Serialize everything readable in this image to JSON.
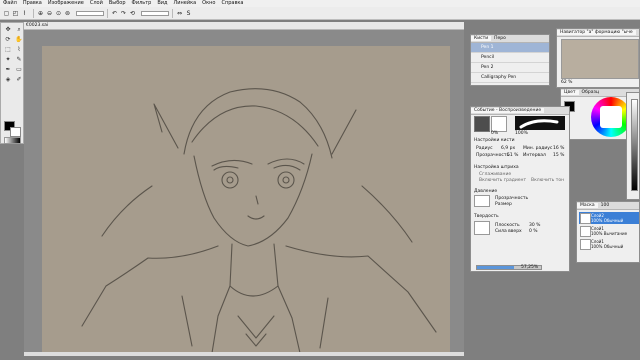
{
  "menu": [
    "Файл",
    "Правка",
    "Изображение",
    "Слой",
    "Выбор",
    "Фильтр",
    "Вид",
    "Линейка",
    "Окно",
    "Справка"
  ],
  "document": {
    "title": "€0023.sai"
  },
  "brushes": {
    "tabs": [
      "Кисти",
      "Перо"
    ],
    "items": [
      "Pen 1",
      "Pencil",
      "Pen 2",
      "Calligraphy Pen"
    ],
    "selected_index": 0
  },
  "navigator": {
    "title": "Навигатор \"a\" формацию \"ыче",
    "zoom": "62 %"
  },
  "color": {
    "tab": "Цвет",
    "tab2": "Образц"
  },
  "brush_settings": {
    "title": "Событие - Воспроизведение",
    "section_brush": "Настройки кисти",
    "radius_label": "Радиус",
    "radius_value": "6,9 px",
    "min_radius_label": "Мин. радиус",
    "min_radius_value": "16 %",
    "transparency_label": "Прозрачность",
    "transparency_value": "51 %",
    "interval_label": "Интервал",
    "interval_value": "15 %",
    "section_stroke": "Настройка штриха",
    "stroke_opt1": "Сглаживание",
    "stroke_opt2": "Включить градиент",
    "stroke_opt3": "Включить тон",
    "pressure_label": "Давление",
    "pressure_opt1": "Прозрачность",
    "pressure_opt2": "Размер",
    "hardness_label": "Твердость",
    "flatness_label": "Плоскость",
    "flatness_value": "30 %",
    "power_label": "Сила вверх",
    "power_value": "0 %",
    "preset_0": "0%",
    "preset_100": "100%",
    "progress_text": "57,25%",
    "progress_value": 0.5725
  },
  "layers": {
    "tab": "Маска",
    "opacity": "100",
    "items": [
      {
        "name": "Слой2",
        "mode": "100% Обычный",
        "selected": true
      },
      {
        "name": "Слой1",
        "mode": "100% Вычитание",
        "selected": false
      },
      {
        "name": "Слой1",
        "mode": "100% Обычный",
        "selected": false
      }
    ]
  }
}
